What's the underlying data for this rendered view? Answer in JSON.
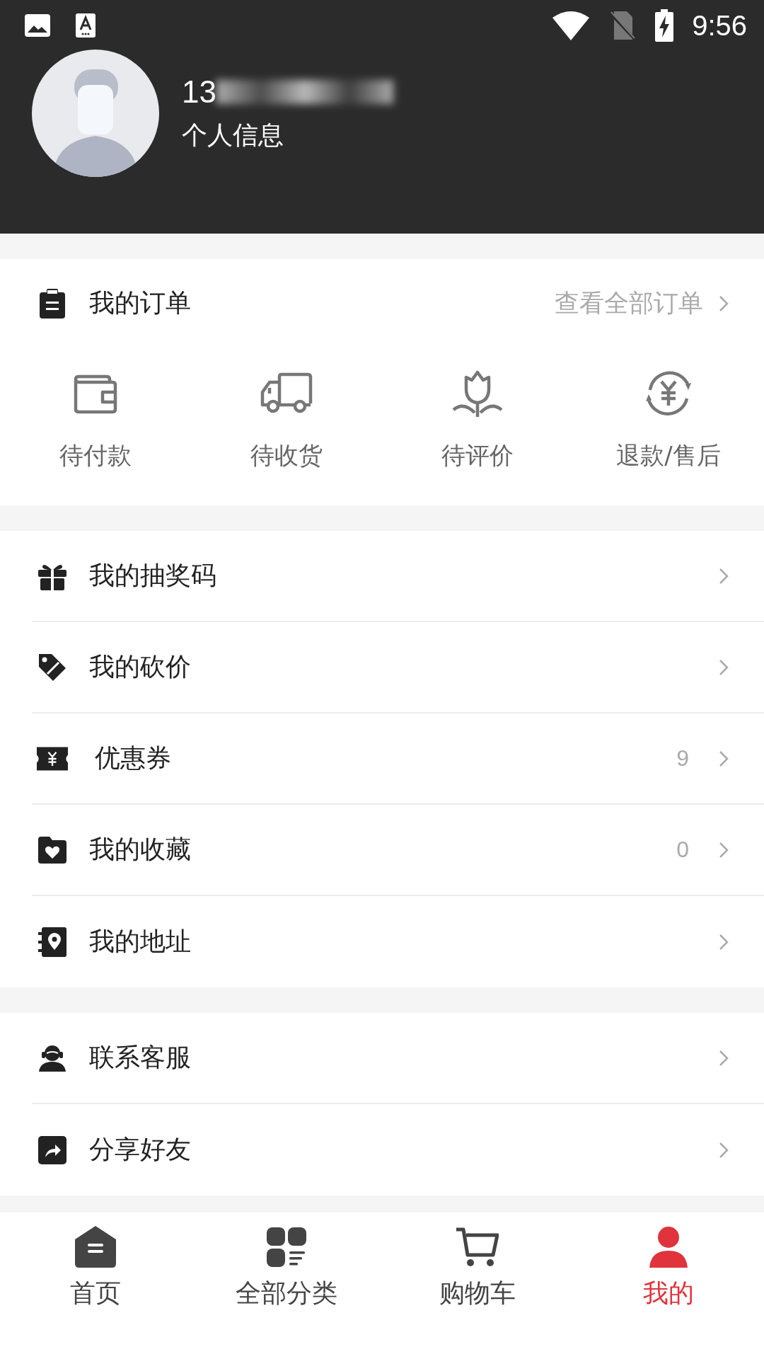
{
  "status_bar": {
    "time": "9:56"
  },
  "profile": {
    "phone": "13",
    "phone_blurred": true,
    "subtitle": "个人信息"
  },
  "orders": {
    "title": "我的订单",
    "link": "查看全部订单",
    "items": [
      {
        "kind": "wallet",
        "label": "待付款"
      },
      {
        "kind": "truck",
        "label": "待收货"
      },
      {
        "kind": "flower",
        "label": "待评价"
      },
      {
        "kind": "refund",
        "label": "退款/售后"
      }
    ]
  },
  "menu_groups": [
    [
      {
        "kind": "gift",
        "label": "我的抽奖码"
      },
      {
        "kind": "tag",
        "label": "我的砍价"
      },
      {
        "kind": "coupon",
        "label": "优惠券",
        "count": "9"
      },
      {
        "kind": "favorite",
        "label": "我的收藏",
        "count": "0"
      },
      {
        "kind": "address",
        "label": "我的地址"
      }
    ],
    [
      {
        "kind": "service",
        "label": "联系客服"
      },
      {
        "kind": "share",
        "label": "分享好友"
      }
    ]
  ],
  "tab_bar": [
    {
      "kind": "home",
      "label": "首页",
      "selected": false
    },
    {
      "kind": "category",
      "label": "全部分类",
      "selected": false
    },
    {
      "kind": "cart",
      "label": "购物车",
      "selected": false
    },
    {
      "kind": "me",
      "label": "我的",
      "selected": true
    }
  ]
}
